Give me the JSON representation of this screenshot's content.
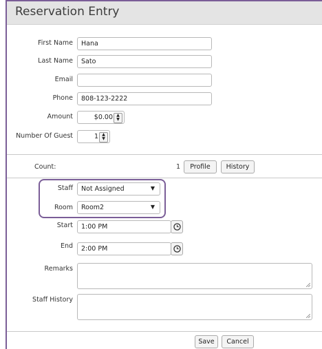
{
  "window": {
    "title": "Reservation Entry"
  },
  "form": {
    "first_name": {
      "label": "First Name",
      "value": "Hana"
    },
    "last_name": {
      "label": "Last Name",
      "value": "Sato"
    },
    "email": {
      "label": "Email",
      "value": ""
    },
    "phone": {
      "label": "Phone",
      "value": "808-123-2222"
    },
    "amount": {
      "label": "Amount",
      "value": "$0.00"
    },
    "guests": {
      "label": "Number Of Guest",
      "value": "1"
    }
  },
  "count": {
    "label": "Count:",
    "value": "1",
    "profile_label": "Profile",
    "history_label": "History"
  },
  "assignment": {
    "staff": {
      "label": "Staff",
      "value": "Not Assigned"
    },
    "room": {
      "label": "Room",
      "value": "Room2"
    }
  },
  "times": {
    "start": {
      "label": "Start",
      "value": "1:00 PM"
    },
    "end": {
      "label": "End",
      "value": "2:00 PM"
    }
  },
  "notes": {
    "remarks": {
      "label": "Remarks",
      "value": ""
    },
    "staff_history": {
      "label": "Staff History",
      "value": ""
    }
  },
  "actions": {
    "save_label": "Save",
    "cancel_label": "Cancel"
  },
  "colors": {
    "highlight": "#7a5d97",
    "title_bg": "#e4e4e4"
  },
  "icons": {
    "clock": "clock-icon",
    "spinner": "spinner-arrows-icon",
    "dropdown": "chevron-down-icon"
  }
}
